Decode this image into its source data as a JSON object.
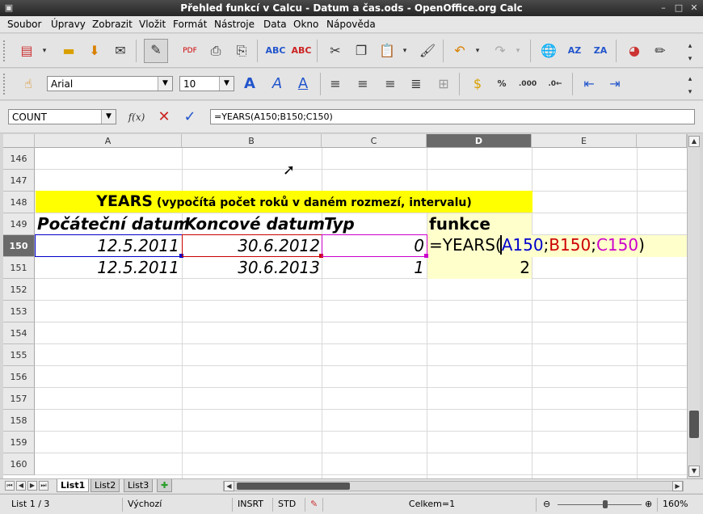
{
  "window": {
    "title": "Přehled funkcí v Calcu - Datum a čas.ods - OpenOffice.org Calc"
  },
  "menu": [
    "Soubor",
    "Úpravy",
    "Zobrazit",
    "Vložit",
    "Formát",
    "Nástroje",
    "Data",
    "Okno",
    "Nápověda"
  ],
  "formatting": {
    "font_name": "Arial",
    "font_size": "10"
  },
  "formula_bar": {
    "name_box": "COUNT",
    "fx_label": "f(x)",
    "formula": "=YEARS(A150;B150;C150)"
  },
  "columns": [
    "A",
    "B",
    "C",
    "D",
    "E"
  ],
  "rows": [
    "146",
    "147",
    "148",
    "149",
    "150",
    "151",
    "152",
    "153",
    "154",
    "155",
    "156",
    "157",
    "158",
    "159",
    "160"
  ],
  "banner": {
    "strong": "YEARS",
    "rest": " (vypočítá počet roků v daném rozmezí, intervalu)"
  },
  "headers": {
    "a": "Počáteční datum",
    "b": "Koncové datum",
    "c": "Typ",
    "d": "funkce"
  },
  "row150": {
    "a": "12.5.2011",
    "b": "30.6.2012",
    "c": "0",
    "d_prefix": "=YEARS(",
    "ref_a": "A150",
    "sep1": ";",
    "ref_b": "B150",
    "sep2": ";",
    "ref_c": "C150",
    "d_suffix": ")"
  },
  "row151": {
    "a": "12.5.2011",
    "b": "30.6.2013",
    "c": "1",
    "d": "2"
  },
  "sheets": [
    "List1",
    "List2",
    "List3"
  ],
  "status": {
    "page": "List 1 / 3",
    "style": "Výchozí",
    "mode": "INSRT",
    "selection": "STD",
    "sum": "Celkem=1",
    "zoom": "160%"
  },
  "colors": {
    "ref_a": "#0000cc",
    "ref_b": "#cc0000",
    "ref_c": "#cc00cc",
    "banner": "#ffff00",
    "formula_cell": "#ffffcc"
  }
}
